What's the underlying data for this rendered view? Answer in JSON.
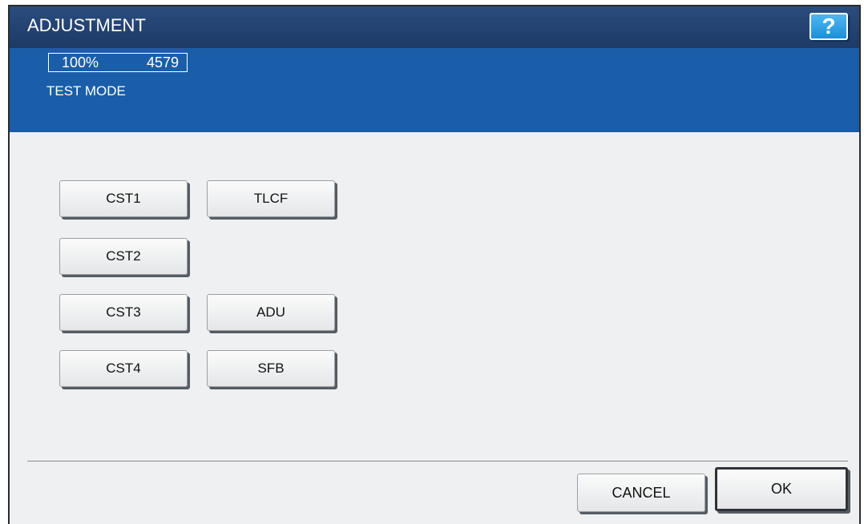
{
  "window": {
    "title": "ADJUSTMENT",
    "help_label": "?"
  },
  "status": {
    "zoom": "100%",
    "count": "4579",
    "mode": "TEST MODE"
  },
  "buttons": {
    "cst1": "CST1",
    "tlcf": "TLCF",
    "cst2": "CST2",
    "cst3": "CST3",
    "adu": "ADU",
    "cst4": "CST4",
    "sfb": "SFB"
  },
  "footer": {
    "cancel_label": "CANCEL",
    "ok_label": "OK"
  },
  "colors": {
    "title_bar": "#1e3a66",
    "status_bar": "#1a5ea9",
    "help_button": "#1b8fd9",
    "background": "#eef0f1"
  }
}
